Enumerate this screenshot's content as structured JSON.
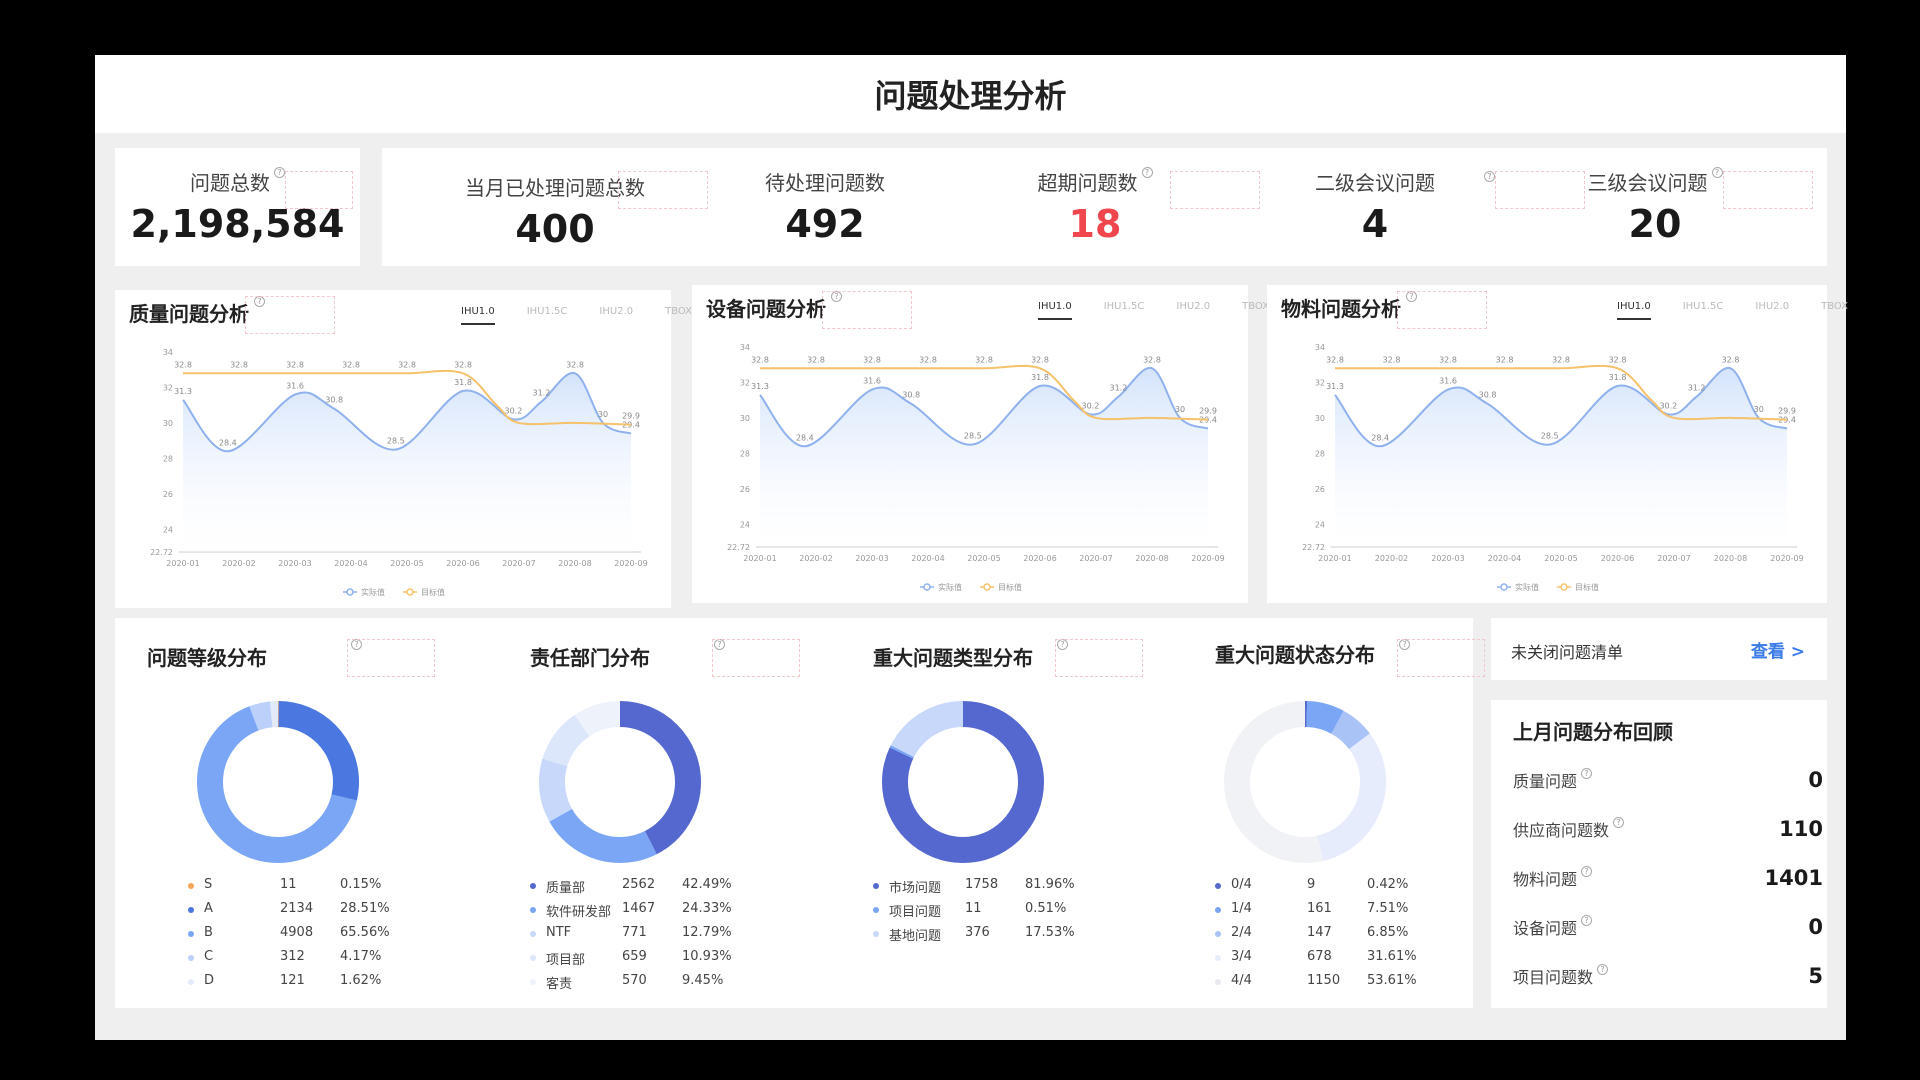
{
  "page_title": "问题处理分析",
  "kpis": [
    {
      "label": "问题总数",
      "value": "2,198,584",
      "color": "#1a1a1a"
    },
    {
      "label": "当月已处理问题总数",
      "value": "400",
      "color": "#1a1a1a"
    },
    {
      "label": "待处理问题数",
      "value": "492",
      "color": "#1a1a1a"
    },
    {
      "label": "超期问题数",
      "value": "18",
      "color": "#f0474e"
    },
    {
      "label": "二级会议问题",
      "value": "4",
      "color": "#1a1a1a"
    },
    {
      "label": "三级会议问题",
      "value": "20",
      "color": "#1a1a1a"
    }
  ],
  "line_charts": [
    {
      "title": "质量问题分析"
    },
    {
      "title": "设备问题分析"
    },
    {
      "title": "物料问题分析"
    }
  ],
  "tabs": [
    "IHU1.0",
    "IHU1.5C",
    "IHU2.0",
    "TBOX"
  ],
  "chart_data": {
    "type": "line",
    "x": [
      "2020-01",
      "2020-02",
      "2020-03",
      "2020-04",
      "2020-05",
      "2020-06",
      "2020-07",
      "2020-08",
      "2020-09"
    ],
    "yticks": [
      "34",
      "32",
      "30",
      "28",
      "26",
      "24",
      "22.72"
    ],
    "ylim": [
      22.72,
      34
    ],
    "series": [
      {
        "name": "实际值",
        "color": "#8fb1ee",
        "points": [
          [
            1,
            31.3
          ],
          [
            1.8,
            28.4
          ],
          [
            3,
            31.6
          ],
          [
            3.7,
            30.8
          ],
          [
            4.8,
            28.5
          ],
          [
            6,
            31.8
          ],
          [
            6.9,
            30.2
          ],
          [
            7.4,
            31.2
          ],
          [
            8,
            32.8
          ],
          [
            8.5,
            30
          ],
          [
            9,
            29.4
          ]
        ],
        "labels": [
          [
            1,
            31.3,
            "31.3"
          ],
          [
            1.8,
            28.4,
            "28.4"
          ],
          [
            3,
            31.6,
            "31.6"
          ],
          [
            3.7,
            30.8,
            "30.8"
          ],
          [
            4.8,
            28.5,
            "28.5"
          ],
          [
            6,
            31.8,
            "31.8"
          ],
          [
            6.9,
            30.2,
            "30.2"
          ],
          [
            7.4,
            31.2,
            "31.2"
          ],
          [
            8,
            32.8,
            "32.8"
          ],
          [
            8.5,
            30,
            "30"
          ],
          [
            9,
            29.4,
            "29.4"
          ]
        ]
      },
      {
        "name": "目标值",
        "color": "#f5c16a",
        "points": [
          [
            1,
            32.8
          ],
          [
            2,
            32.8
          ],
          [
            3,
            32.8
          ],
          [
            4,
            32.8
          ],
          [
            5,
            32.8
          ],
          [
            6,
            32.8
          ],
          [
            6.6,
            31.0
          ],
          [
            7,
            30.0
          ],
          [
            8,
            30
          ],
          [
            9,
            29.9
          ]
        ],
        "labels": [
          [
            1,
            32.8,
            "32.8"
          ],
          [
            2,
            32.8,
            "32.8"
          ],
          [
            3,
            32.8,
            "32.8"
          ],
          [
            4,
            32.8,
            "32.8"
          ],
          [
            5,
            32.8,
            "32.8"
          ],
          [
            6,
            32.8,
            "32.8"
          ],
          [
            9,
            29.9,
            "29.9"
          ]
        ]
      }
    ]
  },
  "distributions": [
    {
      "title": "问题等级分布",
      "slices": [
        {
          "name": "S",
          "count": "11",
          "pct": "0.15%",
          "value": 0.15,
          "color": "#f5a35c"
        },
        {
          "name": "A",
          "count": "2134",
          "pct": "28.51%",
          "value": 28.51,
          "color": "#4a77e0"
        },
        {
          "name": "B",
          "count": "4908",
          "pct": "65.56%",
          "value": 65.56,
          "color": "#7aa6f5"
        },
        {
          "name": "C",
          "count": "312",
          "pct": "4.17%",
          "value": 4.17,
          "color": "#bcd1fa"
        },
        {
          "name": "D",
          "count": "121",
          "pct": "1.62%",
          "value": 1.62,
          "color": "#e3ebfb"
        }
      ]
    },
    {
      "title": "责任部门分布",
      "slices": [
        {
          "name": "质量部",
          "count": "2562",
          "pct": "42.49%",
          "value": 42.49,
          "color": "#5568cf"
        },
        {
          "name": "软件研发部",
          "count": "1467",
          "pct": "24.33%",
          "value": 24.33,
          "color": "#7aa6f5"
        },
        {
          "name": "NTF",
          "count": "771",
          "pct": "12.79%",
          "value": 12.79,
          "color": "#c7d8fa"
        },
        {
          "name": "项目部",
          "count": "659",
          "pct": "10.93%",
          "value": 10.93,
          "color": "#dde7fb"
        },
        {
          "name": "客责",
          "count": "570",
          "pct": "9.45%",
          "value": 9.45,
          "color": "#eef2fb"
        }
      ]
    },
    {
      "title": "重大问题类型分布",
      "slices": [
        {
          "name": "市场问题",
          "count": "1758",
          "pct": "81.96%",
          "value": 81.96,
          "color": "#5568cf"
        },
        {
          "name": "项目问题",
          "count": "11",
          "pct": "0.51%",
          "value": 0.51,
          "color": "#7aa6f5"
        },
        {
          "name": "基地问题",
          "count": "376",
          "pct": "17.53%",
          "value": 17.53,
          "color": "#c7d8fa"
        }
      ]
    },
    {
      "title": "重大问题状态分布",
      "slices": [
        {
          "name": "0/4",
          "count": "9",
          "pct": "0.42%",
          "value": 0.42,
          "color": "#5568cf"
        },
        {
          "name": "1/4",
          "count": "161",
          "pct": "7.51%",
          "value": 7.51,
          "color": "#7aa6f5"
        },
        {
          "name": "2/4",
          "count": "147",
          "pct": "6.85%",
          "value": 6.85,
          "color": "#a9c3f7"
        },
        {
          "name": "3/4",
          "count": "678",
          "pct": "31.61%",
          "value": 31.61,
          "color": "#e6ecfb"
        },
        {
          "name": "4/4",
          "count": "1150",
          "pct": "53.61%",
          "value": 53.61,
          "color": "#f1f2f5"
        }
      ]
    }
  ],
  "unclosed": {
    "label": "未关闭问题清单",
    "link": "查看 >"
  },
  "review": {
    "title": "上月问题分布回顾",
    "rows": [
      {
        "label": "质量问题",
        "value": "0"
      },
      {
        "label": "供应商问题数",
        "value": "110"
      },
      {
        "label": "物料问题",
        "value": "1401"
      },
      {
        "label": "设备问题",
        "value": "0"
      },
      {
        "label": "项目问题数",
        "value": "5"
      }
    ]
  }
}
